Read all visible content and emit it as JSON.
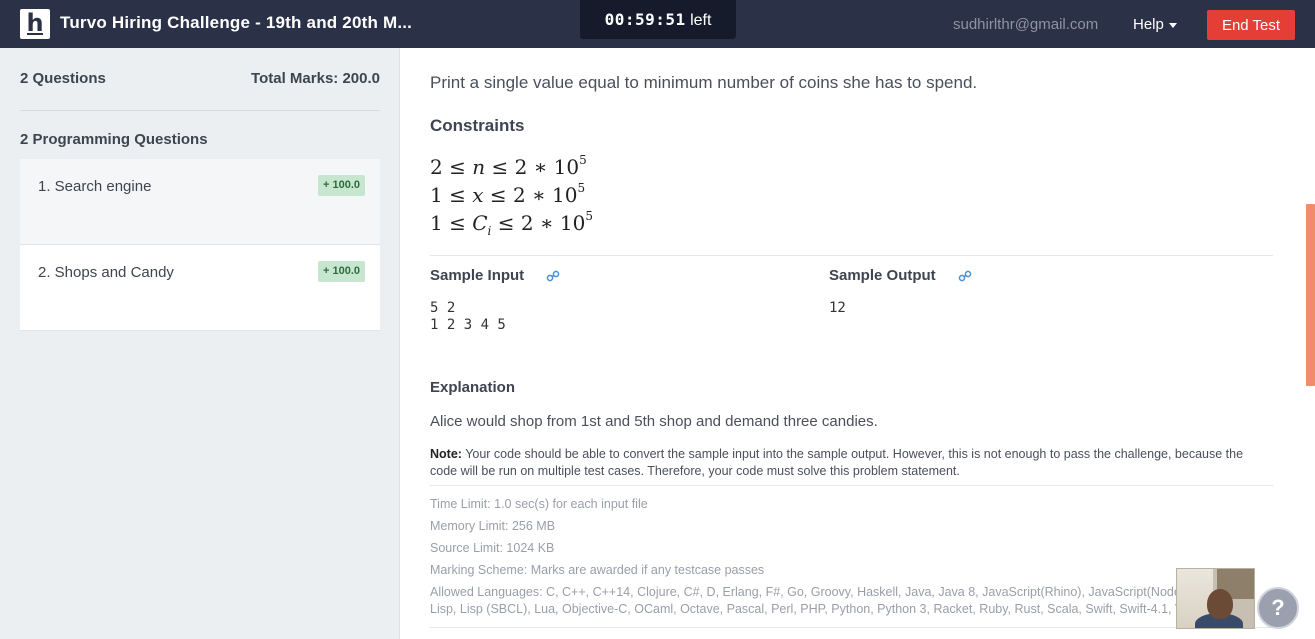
{
  "header": {
    "title": "Turvo Hiring Challenge - 19th and 20th M...",
    "timer": "00:59:51",
    "timer_suffix": "left",
    "email": "sudhirlthr@gmail.com",
    "help_label": "Help",
    "end_test_label": "End Test",
    "logo_letter": "h"
  },
  "sidebar": {
    "question_count": "2 Questions",
    "total_marks": "Total Marks: 200.0",
    "section_title": "2 Programming Questions",
    "questions": [
      {
        "label": "1. Search engine",
        "marks": "+ 100.0"
      },
      {
        "label": "2. Shops and Candy",
        "marks": "+ 100.0"
      }
    ]
  },
  "problem": {
    "output_text": "Print a single value equal to minimum number of coins she has to spend.",
    "constraints_title": "Constraints",
    "constraints": [
      {
        "pre": "2 ≤ ",
        "var": "n",
        "sub": "",
        "post": " ≤ 2 ∗ 10",
        "exp": "5"
      },
      {
        "pre": "1 ≤ ",
        "var": "x",
        "sub": "",
        "post": " ≤ 2 ∗ 10",
        "exp": "5"
      },
      {
        "pre": "1 ≤ ",
        "var": "C",
        "sub": "i",
        "post": " ≤ 2 ∗ 10",
        "exp": "5"
      }
    ],
    "sample_input_title": "Sample Input",
    "sample_input": "5 2\n1 2 3 4 5",
    "sample_output_title": "Sample Output",
    "sample_output": "12",
    "explanation_title": "Explanation",
    "explanation": "Alice would shop from 1st and 5th shop and demand three candies.",
    "note_label": "Note:",
    "note_text": "Your code should be able to convert the sample input into the sample output. However, this is not enough to pass the challenge, because the code will be run on multiple test cases. Therefore, your code must solve this problem statement.",
    "time_limit": "Time Limit: 1.0 sec(s) for each input file",
    "memory_limit": "Memory Limit: 256 MB",
    "source_limit": "Source Limit: 1024 KB",
    "marking_scheme": "Marking Scheme: Marks are awarded if any testcase passes",
    "allowed_languages_line1": "Allowed Languages: C, C++, C++14, Clojure, C#, D, Erlang, F#, Go, Groovy, Haskell, Java, Java 8, JavaScript(Rhino), JavaScript(Node.js),",
    "allowed_languages_line2": "Lisp, Lisp (SBCL), Lua, Objective-C, OCaml, Octave, Pascal, Perl, PHP, Python, Python 3, Racket, Ruby, Rust, Scala, Swift, Swift-4.1, Visual Basic"
  },
  "help_bubble": "?",
  "colors": {
    "header_bg": "#2b3147",
    "end_test": "#e53e37",
    "badge_bg": "#c7e6cf",
    "scroll_thumb": "#ef8d68"
  }
}
